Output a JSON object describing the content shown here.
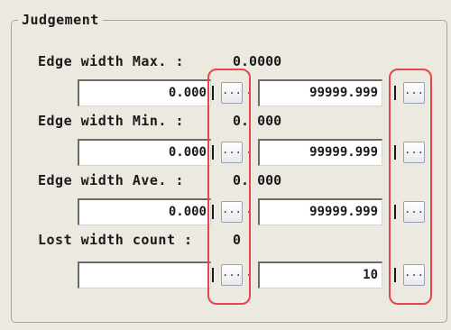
{
  "group": {
    "title": "Judgement"
  },
  "rows": [
    {
      "label": "Edge width Max. :",
      "value": "0.0000",
      "lower": "0.000",
      "upper": "99999.999"
    },
    {
      "label": "Edge width Min. :",
      "value": "0. 000",
      "lower": "0.000",
      "upper": "99999.999"
    },
    {
      "label": "Edge width Ave. :",
      "value": "0. 000",
      "lower": "0.000",
      "upper": "99999.999"
    },
    {
      "label": "Lost width count :",
      "value": "0",
      "lower": "",
      "upper": "10"
    }
  ],
  "buttons": {
    "ellipsis_label": "..."
  },
  "highlight_color": "#e8444b"
}
